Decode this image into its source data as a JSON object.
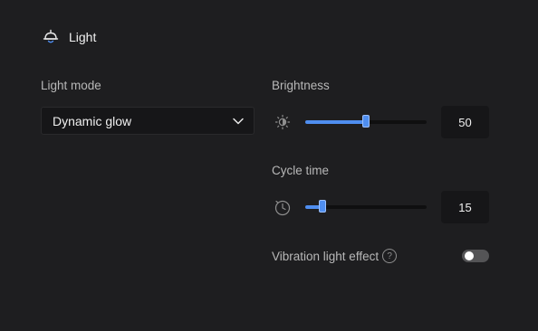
{
  "header": {
    "icon": "lamp-icon",
    "title": "Light"
  },
  "light_mode": {
    "label": "Light mode",
    "selected": "Dynamic glow"
  },
  "brightness": {
    "label": "Brightness",
    "icon": "brightness-icon",
    "value": "50",
    "fraction": 0.5
  },
  "cycle_time": {
    "label": "Cycle time",
    "icon": "timer-icon",
    "value": "15",
    "fraction": 0.14
  },
  "vibration": {
    "label": "Vibration light effect",
    "help_icon": "question-icon",
    "help_glyph": "?",
    "enabled": false
  },
  "colors": {
    "background": "#1e1e20",
    "accent": "#4f8ef0",
    "toggle_off": "#545456"
  }
}
